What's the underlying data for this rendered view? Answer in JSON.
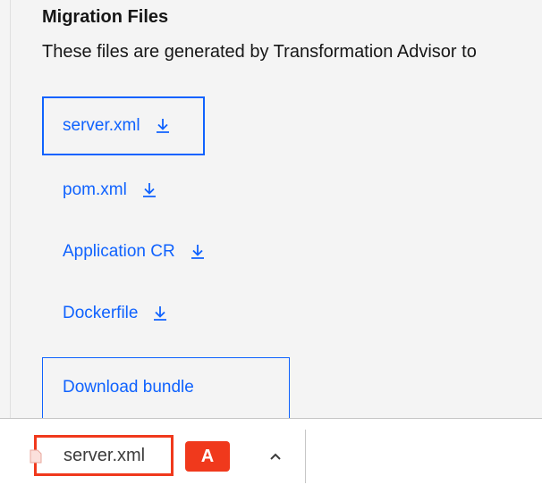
{
  "section": {
    "title": "Migration Files",
    "description": "These files are generated by Transformation Advisor to"
  },
  "files": [
    {
      "label": "server.xml",
      "focused": true
    },
    {
      "label": "pom.xml",
      "focused": false
    },
    {
      "label": "Application CR",
      "focused": false
    },
    {
      "label": "Dockerfile",
      "focused": false
    }
  ],
  "bundle": {
    "label": "Download bundle"
  },
  "download_bar": {
    "item": {
      "name": "server.xml",
      "icon": "file-icon"
    },
    "badge": "A",
    "expand_icon": "chevron-up-icon"
  },
  "colors": {
    "link": "#0f62fe",
    "highlight": "#f0391c"
  }
}
